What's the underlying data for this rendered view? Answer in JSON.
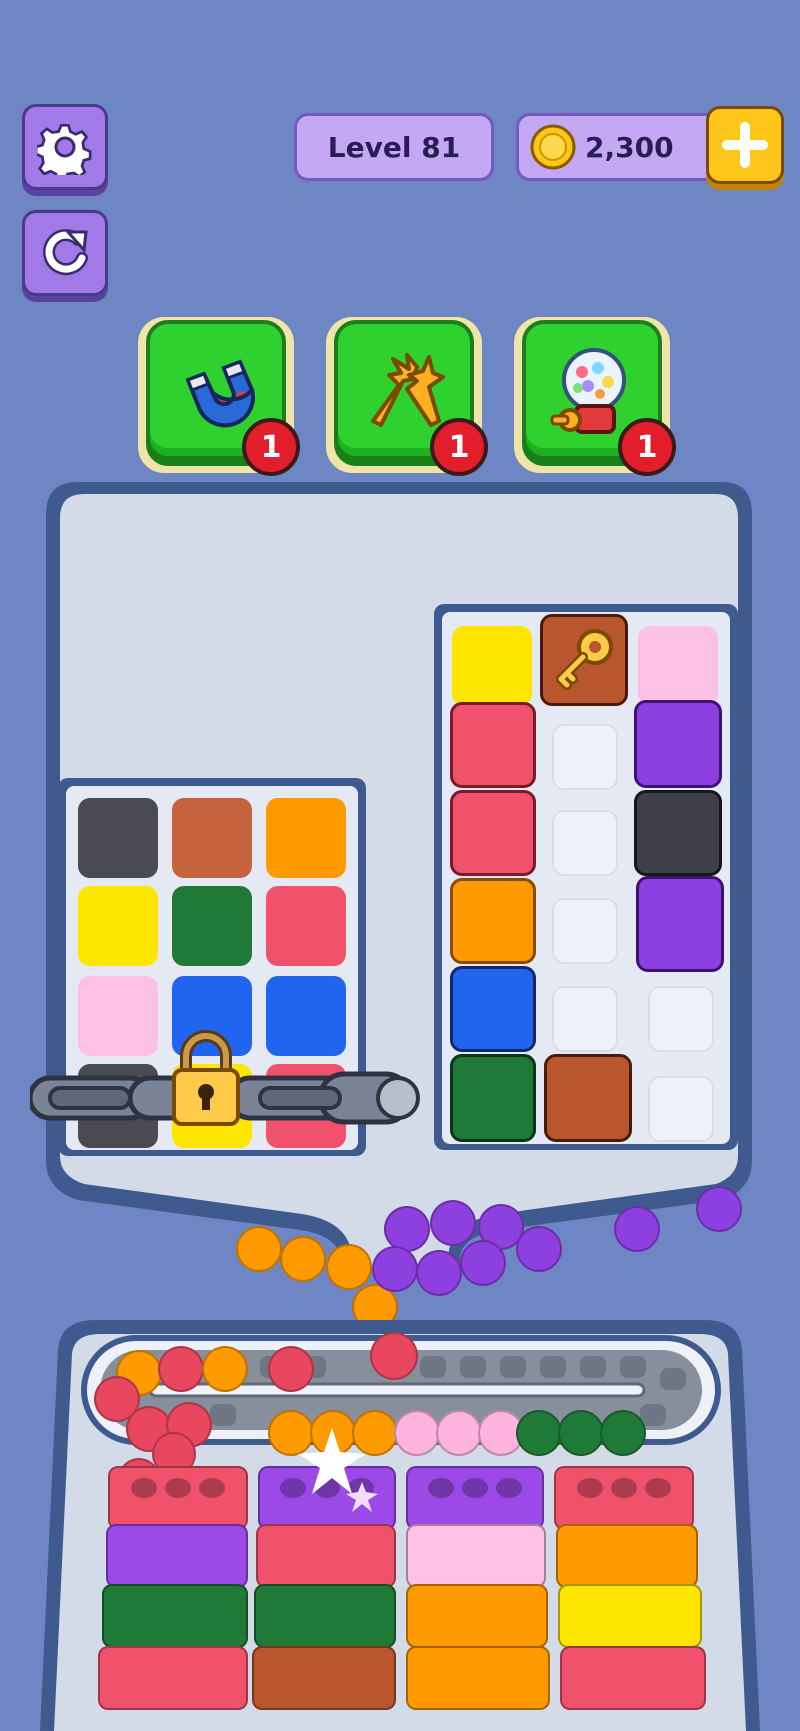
{
  "header": {
    "level_label": "Level 81",
    "coins": "2,300"
  },
  "boosters": [
    {
      "name": "magnet",
      "count": "1"
    },
    {
      "name": "shuffle",
      "count": "1"
    },
    {
      "name": "gumball-machine",
      "count": "1"
    }
  ],
  "colors": {
    "background": "#6f86c4",
    "button_purple": "#a17ae8",
    "booster_green": "#2fd12f",
    "badge_red": "#e21e2d",
    "gold": "#ffc61a"
  },
  "left_grid": {
    "tiles": [
      "#4a4a54",
      "#c5633c",
      "#ff9a00",
      "#ffe600",
      "#1f7a37",
      "#f0526c",
      "#ffc0e6",
      "#2064ef",
      "#2064ef"
    ],
    "locked": true
  },
  "right_grid": {
    "columns": [
      [
        "yellow",
        "red-stud",
        "red-stud",
        "orange-stud",
        "blue-stud",
        "green-stud"
      ],
      [
        "key",
        "empty",
        "empty",
        "empty",
        "empty",
        "brown-stud"
      ],
      [
        "pink",
        "purple-stud",
        "black-stud",
        "purple-stud",
        "empty",
        "empty"
      ]
    ]
  },
  "conveyor": {
    "marbles": [
      "orange",
      "orange",
      "orange",
      "pink",
      "pink",
      "pink",
      "green",
      "green",
      "green"
    ]
  },
  "bottom_stacks": [
    [
      "red",
      "purple",
      "green",
      "red"
    ],
    [
      "purple",
      "red",
      "green",
      "brown"
    ],
    [
      "purple",
      "pink",
      "orange",
      "orange"
    ],
    [
      "red",
      "orange",
      "yellow",
      "red"
    ]
  ]
}
